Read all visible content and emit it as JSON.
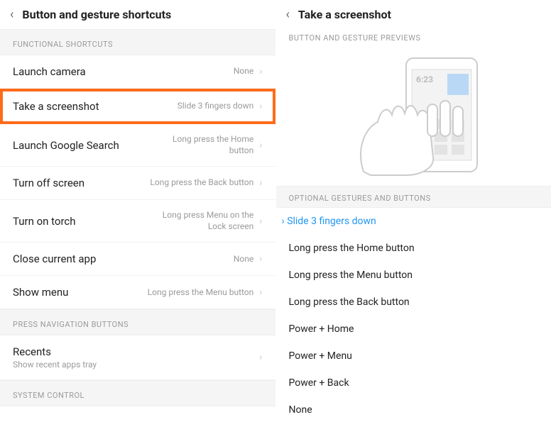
{
  "left": {
    "title": "Button and gesture shortcuts",
    "sections": {
      "functional": "FUNCTIONAL SHORTCUTS",
      "pressNav": "PRESS NAVIGATION BUTTONS",
      "system": "SYSTEM CONTROL"
    },
    "rows": {
      "launchCamera": {
        "label": "Launch camera",
        "value": "None"
      },
      "screenshot": {
        "label": "Take a screenshot",
        "value": "Slide 3 fingers down"
      },
      "googleSearch": {
        "label": "Launch Google Search",
        "value": "Long press the Home button"
      },
      "turnOff": {
        "label": "Turn off screen",
        "value": "Long press the Back button"
      },
      "torch": {
        "label": "Turn on torch",
        "value": "Long press Menu on the Lock screen"
      },
      "closeApp": {
        "label": "Close current app",
        "value": "None"
      },
      "showMenu": {
        "label": "Show menu",
        "value": "Long press the Menu button"
      },
      "recents": {
        "label": "Recents",
        "sub": "Show recent apps tray"
      }
    }
  },
  "right": {
    "title": "Take a screenshot",
    "sectionPreview": "BUTTON AND GESTURE PREVIEWS",
    "sectionOptions": "OPTIONAL GESTURES AND BUTTONS",
    "previewTime": "6:23",
    "options": [
      "Slide 3 fingers down",
      "Long press the Home button",
      "Long press the Menu button",
      "Long press the Back button",
      "Power + Home",
      "Power + Menu",
      "Power + Back",
      "None"
    ]
  }
}
